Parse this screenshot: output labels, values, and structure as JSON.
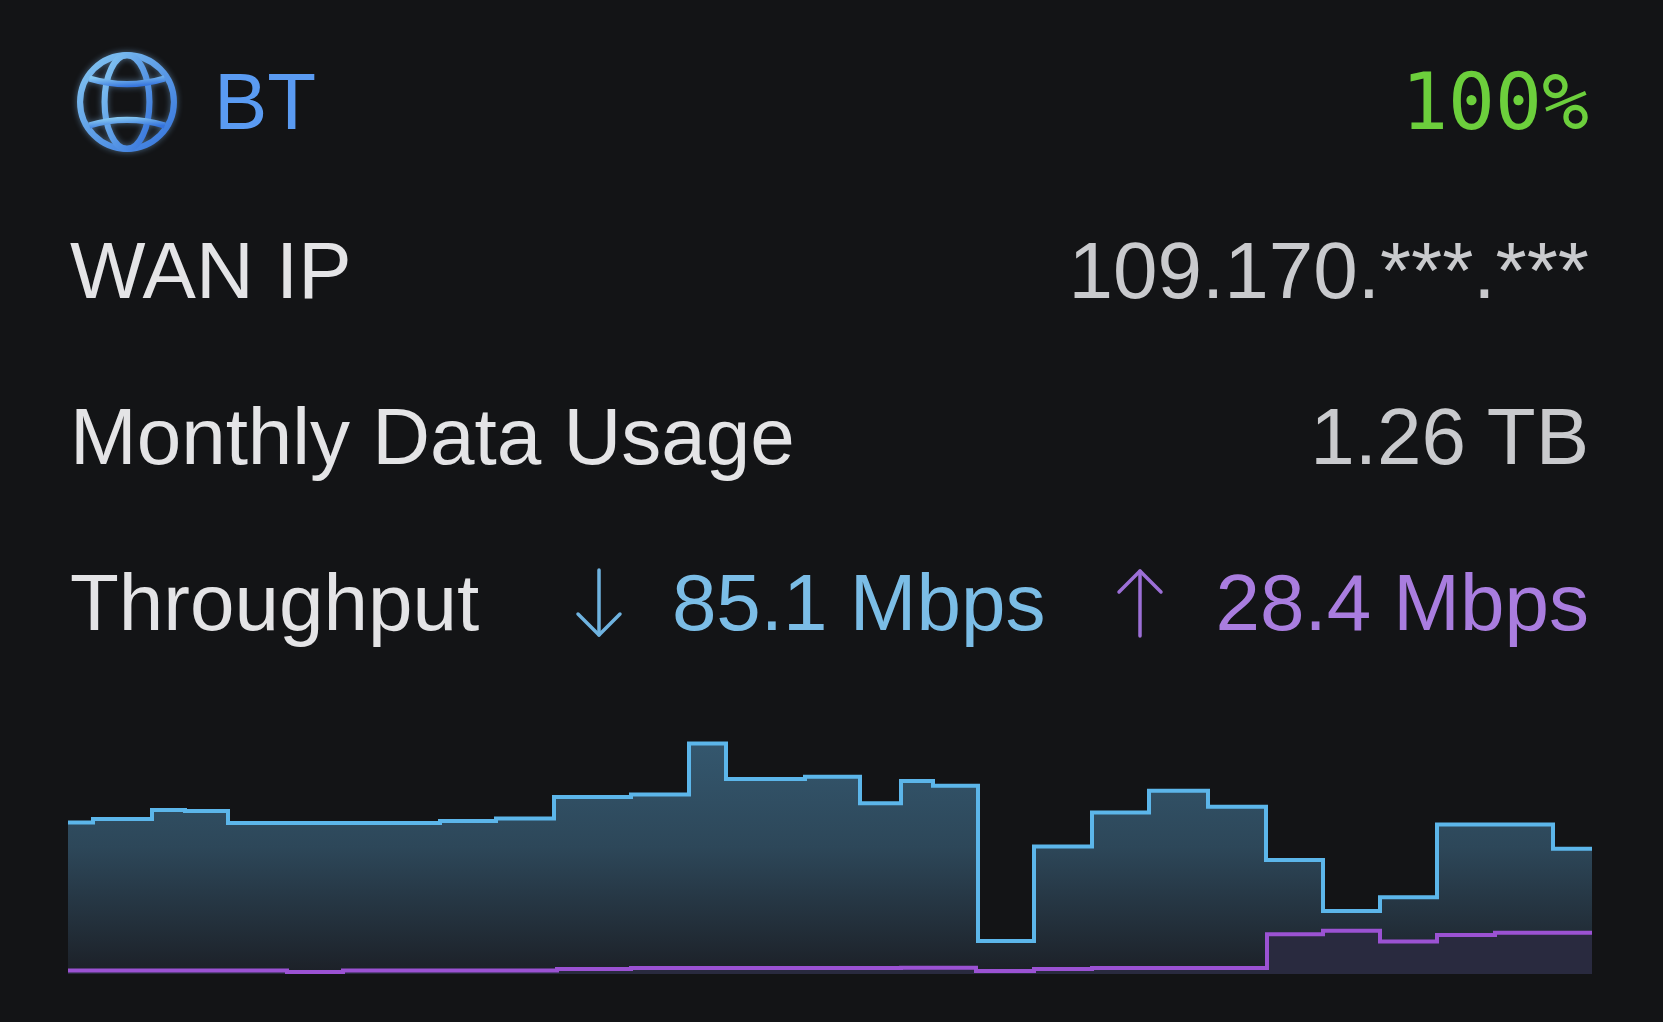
{
  "header": {
    "title": "BT",
    "percentage": "100%"
  },
  "rows": [
    {
      "label": "WAN IP",
      "value": "109.170.***.***"
    },
    {
      "label": "Monthly Data Usage",
      "value": "1.26 TB"
    }
  ],
  "throughput": {
    "label": "Throughput",
    "download": "85.1 Mbps",
    "upload": "28.4 Mbps"
  }
}
